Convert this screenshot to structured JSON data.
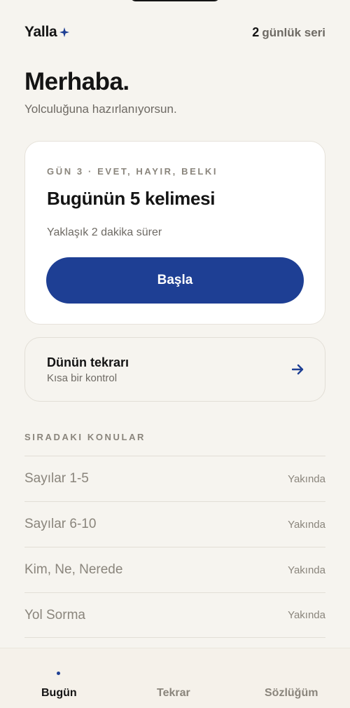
{
  "header": {
    "brand": "Yalla",
    "streak_count": "2",
    "streak_label": "günlük seri"
  },
  "greeting": {
    "title": "Merhaba.",
    "subtitle": "Yolculuğuna hazırlanıyorsun."
  },
  "lesson": {
    "eyebrow": "GÜN 3 · EVET, HAYIR, BELKI",
    "title": "Bugünün 5 kelimesi",
    "duration": "Yaklaşık 2 dakika sürer",
    "start_label": "Başla"
  },
  "review": {
    "title": "Dünün tekrarı",
    "subtitle": "Kısa bir kontrol"
  },
  "topics": {
    "section_label": "SIRADAKI KONULAR",
    "items": [
      {
        "name": "Sayılar 1-5",
        "status": "Yakında"
      },
      {
        "name": "Sayılar 6-10",
        "status": "Yakında"
      },
      {
        "name": "Kim, Ne, Nerede",
        "status": "Yakında"
      },
      {
        "name": "Yol Sorma",
        "status": "Yakında"
      }
    ]
  },
  "nav": {
    "today": "Bugün",
    "review": "Tekrar",
    "dictionary": "Sözlüğüm",
    "active": "today"
  },
  "colors": {
    "accent": "#1e3f94",
    "background": "#f6f4ef",
    "muted_text": "#8a857c"
  },
  "icons": {
    "brand_mark": "sparkle-icon",
    "review_action": "arrow-right-icon"
  }
}
